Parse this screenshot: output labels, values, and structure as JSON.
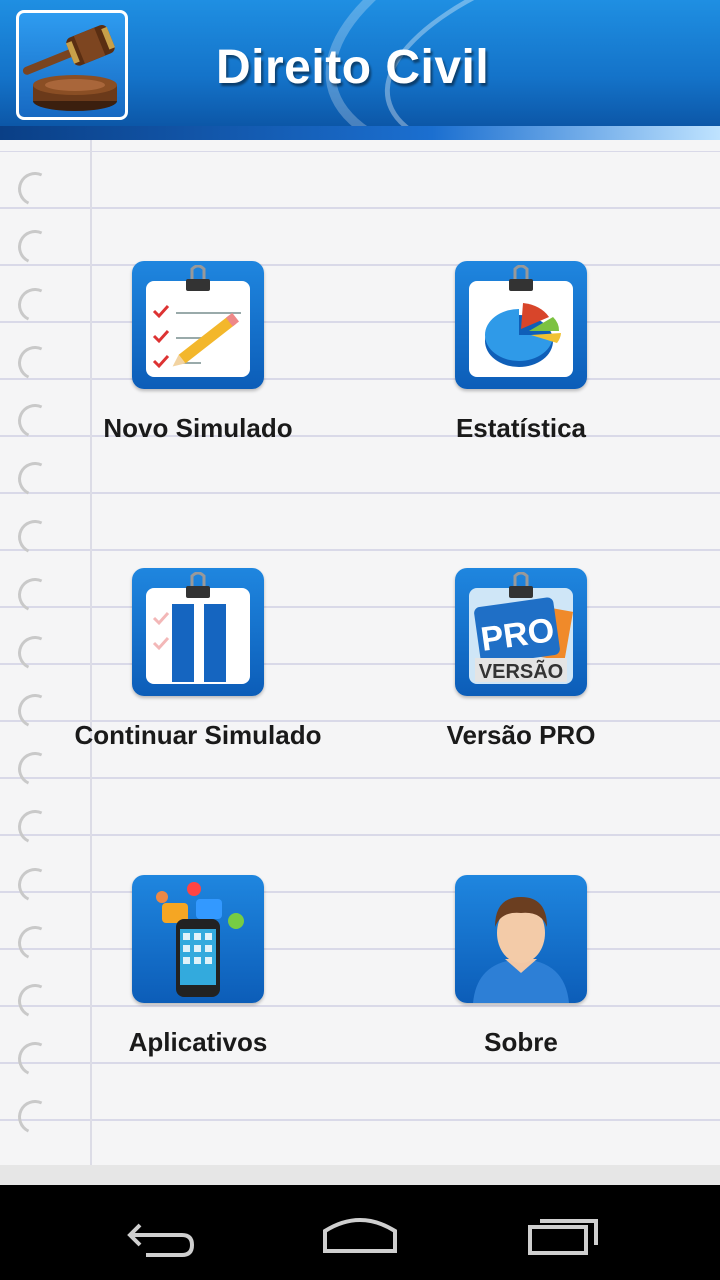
{
  "header": {
    "title": "Direito Civil",
    "logo_icon": "gavel-icon"
  },
  "menu": [
    {
      "label": "Novo Simulado",
      "icon": "checklist-pencil-icon"
    },
    {
      "label": "Estatística",
      "icon": "pie-chart-icon"
    },
    {
      "label": "Continuar Simulado",
      "icon": "pause-checklist-icon"
    },
    {
      "label": "Versão PRO",
      "icon": "pro-version-icon",
      "badge_top": "PRO",
      "badge_bottom": "VERSÃO"
    },
    {
      "label": "Aplicativos",
      "icon": "smartphone-apps-icon"
    },
    {
      "label": "Sobre",
      "icon": "user-avatar-icon"
    }
  ],
  "navbar": {
    "back": "back-icon",
    "home": "home-icon",
    "recents": "recents-icon"
  },
  "colors": {
    "header_blue": "#1473c9",
    "tile_blue": "#0c5db8",
    "paper": "#f5f5f6"
  }
}
